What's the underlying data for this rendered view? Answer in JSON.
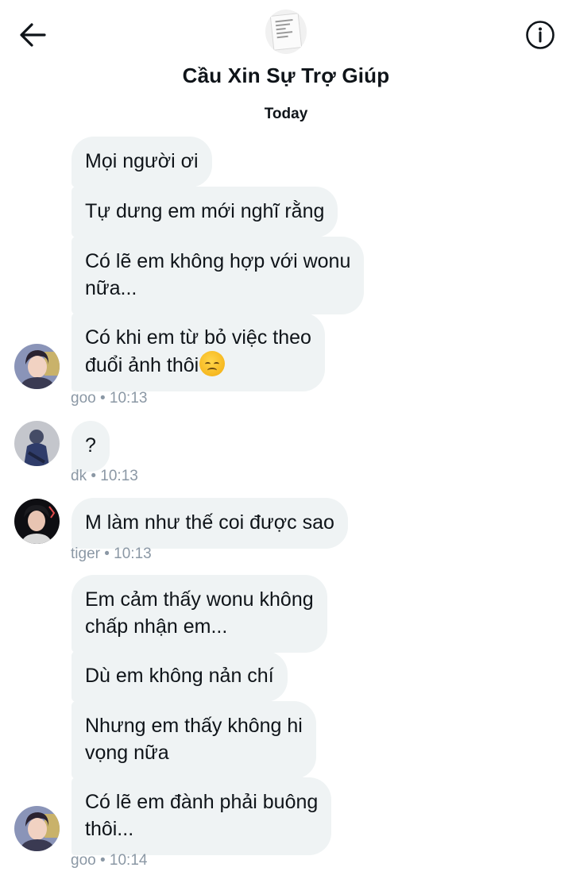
{
  "header": {
    "title": "Cầu Xin Sự Trợ Giúp",
    "date_label": "Today",
    "back_icon": "arrow-left-icon",
    "info_icon": "info-icon"
  },
  "messages": [
    {
      "text": "Mọi người ơi"
    },
    {
      "text": "Tự dưng em mới nghĩ rằng"
    },
    {
      "line1": "Có lẽ em không hợp với wonu",
      "line2": "nữa..."
    },
    {
      "line1": "Có khi em từ bỏ việc theo",
      "line2": "đuổi ảnh thôi"
    },
    {
      "text": "?"
    },
    {
      "text": "M làm như thế coi được sao"
    },
    {
      "line1": "Em cảm thấy wonu không",
      "line2": "chấp nhận em..."
    },
    {
      "text": "Dù em không nản chí"
    },
    {
      "line1": "Nhưng em thấy không hi",
      "line2": "vọng nữa"
    },
    {
      "line1": "Có lẽ em đành phải buông",
      "line2": "thôi..."
    }
  ],
  "meta": {
    "goo_1": "goo • 10:13",
    "dk": "dk • 10:13",
    "tiger": "tiger • 10:13",
    "goo_2": "goo • 10:14"
  },
  "emoji": "disappointed-face-emoji",
  "colors": {
    "bubble_bg": "#eff3f4",
    "meta_text": "#8b98a5",
    "text": "#0f1419"
  }
}
